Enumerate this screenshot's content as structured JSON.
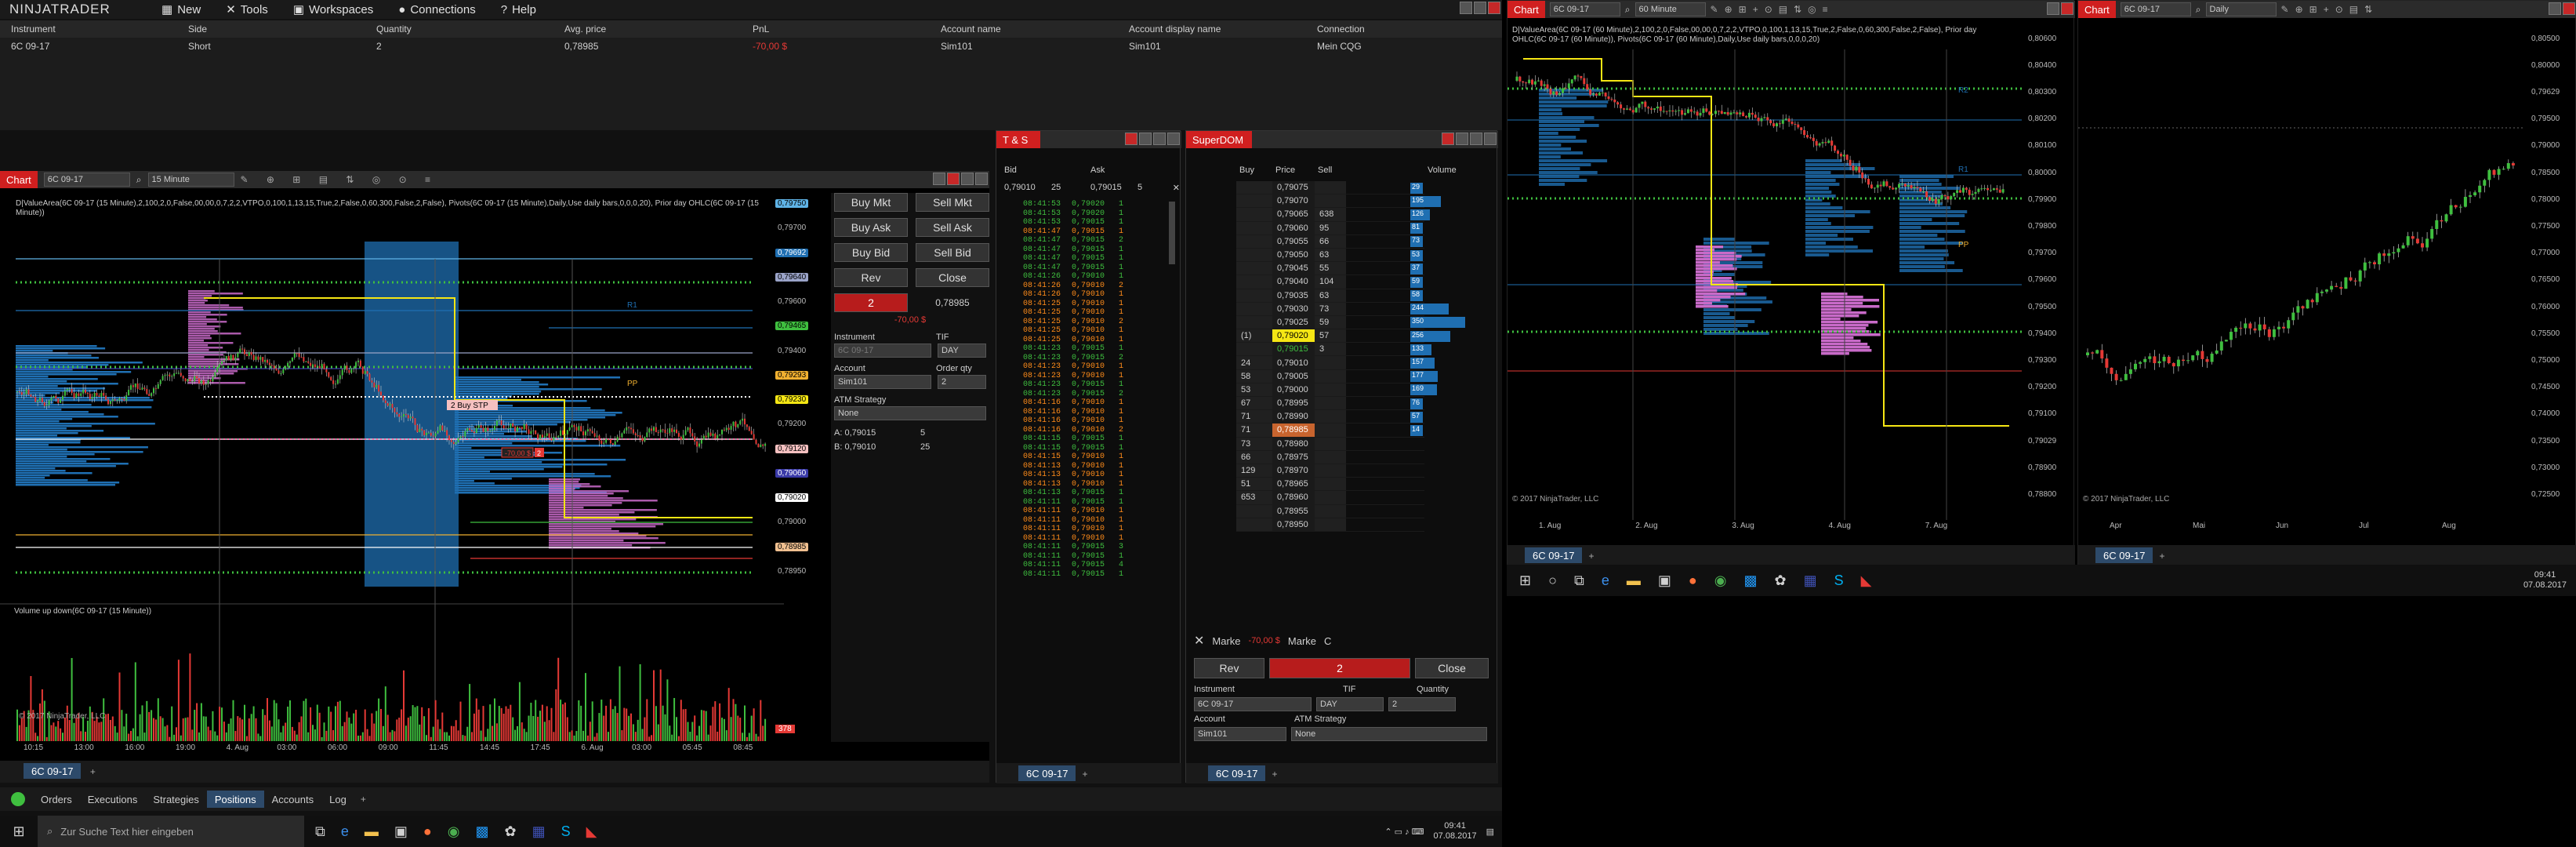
{
  "app": {
    "logo": "NINJATRADER",
    "menu": [
      "New",
      "Tools",
      "Workspaces",
      "Connections",
      "Help"
    ]
  },
  "positions": {
    "headers": [
      "Instrument",
      "Side",
      "Quantity",
      "Avg. price",
      "PnL",
      "Account name",
      "Account display name",
      "Connection"
    ],
    "row": [
      "6C 09-17",
      "Short",
      "2",
      "0,78985",
      "-70,00 $",
      "Sim101",
      "Sim101",
      "Mein CQG"
    ]
  },
  "bottom_tabs": [
    "Orders",
    "Executions",
    "Strategies",
    "Positions",
    "Accounts",
    "Log"
  ],
  "chart1": {
    "title": "Chart",
    "instrument": "6C 09-17",
    "interval": "15 Minute",
    "study": "D|ValueArea(6C 09-17 (15 Minute),2,100,2,0,False,00,00,0,7,2,2,VTPO,0,100,1,13,15,True,2,False,0,60,300,False,2,False), Pivots(6C 09-17 (15 Minute),Daily,Use daily bars,0,0,0,20), Prior day OHLC(6C 09-17 (15 Minute))",
    "subtitle": "Volume up down(6C 09-17 (15 Minute))",
    "copyright": "© 2017 NinjaTrader, LLC",
    "price_labels": [
      "0,79750",
      "0,79700",
      "0,79692",
      "0,79640",
      "0,79600",
      "0,79465",
      "0,79400",
      "0,79293",
      "0,79230",
      "0,79200",
      "0,79120",
      "0,79060",
      "0,79020",
      "0,79000",
      "0,78985",
      "0,78950"
    ],
    "x_labels": [
      "10:15",
      "13:00",
      "16:00",
      "19:00",
      "4. Aug",
      "03:00",
      "06:00",
      "09:00",
      "11:45",
      "14:45",
      "17:45",
      "6. Aug",
      "03:00",
      "05:45",
      "08:45"
    ],
    "labels": {
      "r1": "R1",
      "pp": "PP",
      "buy_stp": "2 Buy STP",
      "short_pnl": "-70,00 $",
      "short_qty": "2",
      "vol_label": "378"
    },
    "tab": "6C 09-17"
  },
  "chart_trader": {
    "buttons": [
      "Buy Mkt",
      "Sell Mkt",
      "Buy Ask",
      "Sell Ask",
      "Buy Bid",
      "Sell Bid",
      "Rev",
      "Close"
    ],
    "position_qty": "2",
    "position_price": "0,78985",
    "pnl": "-70,00 $",
    "instrument_label": "Instrument",
    "tif_label": "TIF",
    "instrument": "6C 09-17",
    "tif": "DAY",
    "account_label": "Account",
    "order_qty_label": "Order qty",
    "account": "Sim101",
    "qty": "2",
    "atm_label": "ATM Strategy",
    "atm": "None",
    "ask_line": "A: 0,79015",
    "ask_size": "5",
    "bid_line": "B: 0,79010",
    "bid_size": "25"
  },
  "ts": {
    "title": "T & S",
    "bid": "Bid",
    "ask": "Ask",
    "bid_val": "0,79010",
    "bid_sz": "25",
    "ask_val": "0,79015",
    "ask_sz": "5",
    "rows": [
      [
        "08:41:53",
        "0,79020",
        "1",
        "g"
      ],
      [
        "08:41:53",
        "0,79020",
        "1",
        "g"
      ],
      [
        "08:41:53",
        "0,79015",
        "1",
        "g"
      ],
      [
        "08:41:47",
        "0,79015",
        "1",
        "o"
      ],
      [
        "08:41:47",
        "0,79015",
        "2",
        "g"
      ],
      [
        "08:41:47",
        "0,79015",
        "1",
        "g"
      ],
      [
        "08:41:47",
        "0,79015",
        "1",
        "g"
      ],
      [
        "08:41:47",
        "0,79015",
        "1",
        "g"
      ],
      [
        "08:41:26",
        "0,79010",
        "1",
        "g"
      ],
      [
        "08:41:26",
        "0,79010",
        "2",
        "o"
      ],
      [
        "08:41:26",
        "0,79010",
        "1",
        "o"
      ],
      [
        "08:41:25",
        "0,79010",
        "1",
        "o"
      ],
      [
        "08:41:25",
        "0,79010",
        "1",
        "o"
      ],
      [
        "08:41:25",
        "0,79010",
        "2",
        "o"
      ],
      [
        "08:41:25",
        "0,79010",
        "1",
        "o"
      ],
      [
        "08:41:25",
        "0,79010",
        "1",
        "o"
      ],
      [
        "08:41:23",
        "0,79015",
        "1",
        "g"
      ],
      [
        "08:41:23",
        "0,79015",
        "2",
        "g"
      ],
      [
        "08:41:23",
        "0,79010",
        "1",
        "o"
      ],
      [
        "08:41:23",
        "0,79010",
        "1",
        "o"
      ],
      [
        "08:41:23",
        "0,79015",
        "1",
        "g"
      ],
      [
        "08:41:23",
        "0,79015",
        "2",
        "g"
      ],
      [
        "08:41:16",
        "0,79010",
        "1",
        "o"
      ],
      [
        "08:41:16",
        "0,79010",
        "1",
        "o"
      ],
      [
        "08:41:16",
        "0,79010",
        "1",
        "o"
      ],
      [
        "08:41:16",
        "0,79010",
        "2",
        "o"
      ],
      [
        "08:41:15",
        "0,79015",
        "1",
        "g"
      ],
      [
        "08:41:15",
        "0,79015",
        "1",
        "g"
      ],
      [
        "08:41:15",
        "0,79010",
        "1",
        "o"
      ],
      [
        "08:41:13",
        "0,79010",
        "1",
        "o"
      ],
      [
        "08:41:13",
        "0,79010",
        "1",
        "o"
      ],
      [
        "08:41:13",
        "0,79010",
        "1",
        "o"
      ],
      [
        "08:41:13",
        "0,79015",
        "1",
        "g"
      ],
      [
        "08:41:11",
        "0,79015",
        "1",
        "g"
      ],
      [
        "08:41:11",
        "0,79010",
        "1",
        "o"
      ],
      [
        "08:41:11",
        "0,79010",
        "1",
        "o"
      ],
      [
        "08:41:11",
        "0,79010",
        "1",
        "o"
      ],
      [
        "08:41:11",
        "0,79010",
        "1",
        "o"
      ],
      [
        "08:41:11",
        "0,79015",
        "3",
        "g"
      ],
      [
        "08:41:11",
        "0,79015",
        "1",
        "g"
      ],
      [
        "08:41:11",
        "0,79015",
        "4",
        "g"
      ],
      [
        "08:41:11",
        "0,79015",
        "1",
        "g"
      ]
    ],
    "tab": "6C 09-17"
  },
  "superdom": {
    "title": "SuperDOM",
    "headers": [
      "Buy",
      "Price",
      "Sell",
      "Volume"
    ],
    "rows": [
      [
        "",
        "0,79075",
        "",
        ""
      ],
      [
        "",
        "0,79070",
        "",
        ""
      ],
      [
        "",
        "0,79065",
        "638",
        ""
      ],
      [
        "",
        "0,79060",
        "95",
        ""
      ],
      [
        "",
        "0,79055",
        "66",
        ""
      ],
      [
        "",
        "0,79050",
        "63",
        ""
      ],
      [
        "",
        "0,79045",
        "55",
        ""
      ],
      [
        "",
        "0,79040",
        "104",
        ""
      ],
      [
        "",
        "0,79035",
        "63",
        ""
      ],
      [
        "",
        "0,79030",
        "73",
        ""
      ],
      [
        "",
        "0,79025",
        "59",
        ""
      ],
      [
        "(1)",
        "0,79020",
        "57",
        "y"
      ],
      [
        "",
        "0,79015",
        "3",
        "g"
      ],
      [
        "24",
        "0,79010",
        "",
        ""
      ],
      [
        "58",
        "0,79005",
        "",
        ""
      ],
      [
        "53",
        "0,79000",
        "",
        ""
      ],
      [
        "67",
        "0,78995",
        "",
        ""
      ],
      [
        "71",
        "0,78990",
        "",
        ""
      ],
      [
        "71",
        "0,78985",
        "",
        "p"
      ],
      [
        "73",
        "0,78980",
        "",
        ""
      ],
      [
        "66",
        "0,78975",
        "",
        ""
      ],
      [
        "129",
        "0,78970",
        "",
        ""
      ],
      [
        "51",
        "0,78965",
        "",
        ""
      ],
      [
        "653",
        "0,78960",
        "",
        ""
      ],
      [
        "",
        "0,78955",
        "",
        ""
      ],
      [
        "",
        "0,78950",
        "",
        ""
      ]
    ],
    "volumes": [
      "29",
      "195",
      "126",
      "81",
      "73",
      "53",
      "37",
      "59",
      "58",
      "244",
      "350",
      "256",
      "133",
      "157",
      "177",
      "169",
      "76",
      "57",
      "14"
    ],
    "market_l": "Marke",
    "pnl": "-70,00 $",
    "market_r": "Marke",
    "c": "C",
    "rev": "Rev",
    "qty": "2",
    "close": "Close",
    "instrument_label": "Instrument",
    "tif_label": "TIF",
    "qty_label": "Quantity",
    "instrument": "6C 09-17",
    "tif": "DAY",
    "quantity": "2",
    "account_label": "Account",
    "atm_label": "ATM Strategy",
    "account": "Sim101",
    "atm": "None",
    "tab": "6C 09-17"
  },
  "chart2": {
    "title": "Chart",
    "instrument": "6C 09-17",
    "interval": "60 Minute",
    "study": "D|ValueArea(6C 09-17 (60 Minute),2,100,2,0,False,00,00,0,7,2,2,VTPO,0,100,1,13,15,True,2,False,0,60,300,False,2,False), Prior day OHLC(6C 09-17 (60 Minute)), Pivots(6C 09-17 (60 Minute),Daily,Use daily bars,0,0,0,20)",
    "prices": [
      "0,80600",
      "0,80400",
      "0,80300",
      "0,80200",
      "0,80100",
      "0,80000",
      "0,79900",
      "0,79800",
      "0,79700",
      "0,79600",
      "0,79500",
      "0,79400",
      "0,79300",
      "0,79200",
      "0,79100",
      "0,79029",
      "0,78900",
      "0,78800"
    ],
    "x_labels": [
      "1. Aug",
      "2. Aug",
      "3. Aug",
      "4. Aug",
      "7. Aug"
    ],
    "r2": "R2",
    "r1": "R1",
    "pp": "PP",
    "copyright": "© 2017 NinjaTrader, LLC",
    "tab": "6C 09-17"
  },
  "chart3": {
    "title": "Chart",
    "instrument": "6C 09-17",
    "interval": "Daily",
    "prices": [
      "0,80500",
      "0,80000",
      "0,79629",
      "0,79500",
      "0,79000",
      "0,78500",
      "0,78000",
      "0,77500",
      "0,77000",
      "0,76500",
      "0,76000",
      "0,75500",
      "0,75000",
      "0,74500",
      "0,74000",
      "0,73500",
      "0,73000",
      "0,72500"
    ],
    "x_labels": [
      "Apr",
      "Mai",
      "Jun",
      "Jul",
      "Aug"
    ],
    "copyright": "© 2017 NinjaTrader, LLC",
    "tab": "6C 09-17"
  },
  "taskbar": {
    "search": "Zur Suche Text hier eingeben",
    "time": "09:41",
    "date": "07.08.2017"
  },
  "taskbar2": {
    "time": "09:41",
    "date": "07.08.2017"
  },
  "colors": {
    "accent": "#d01f1f",
    "up": "#3fbf3f",
    "down": "#ff8c1a",
    "profile_blue": "#1f6fb2",
    "profile_pink": "#c86ac8"
  }
}
